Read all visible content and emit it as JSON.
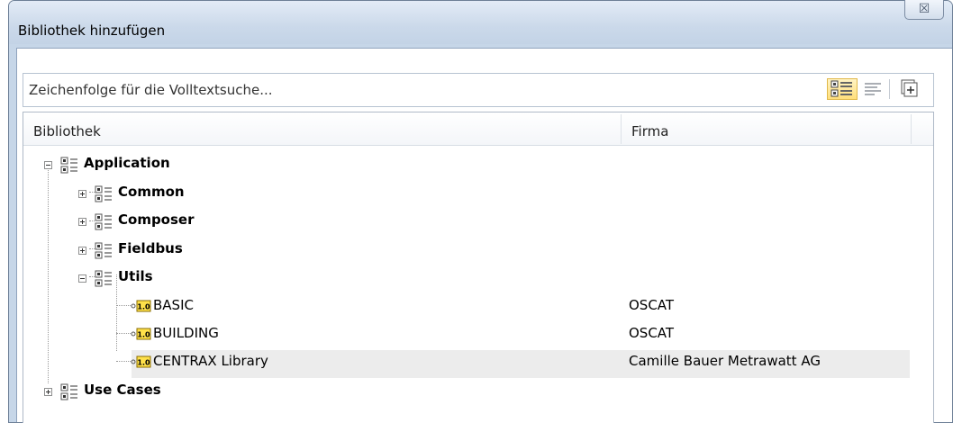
{
  "dialog": {
    "title": "Bibliothek hinzufügen",
    "close_glyph": "☒"
  },
  "search": {
    "placeholder": "Zeichenfolge für die Volltextsuche..."
  },
  "toolbar": {
    "icons": [
      "category-tree-icon",
      "list-view-icon",
      "add-library-icon"
    ]
  },
  "columns": {
    "library": "Bibliothek",
    "company": "Firma"
  },
  "tree": [
    {
      "label": "Application",
      "bold": true,
      "expanded": true,
      "firma": ""
    },
    {
      "label": "Common",
      "bold": true,
      "expanded": false,
      "firma": ""
    },
    {
      "label": "Composer",
      "bold": true,
      "expanded": false,
      "firma": ""
    },
    {
      "label": "Fieldbus",
      "bold": true,
      "expanded": false,
      "firma": ""
    },
    {
      "label": "Utils",
      "bold": true,
      "expanded": true,
      "firma": ""
    },
    {
      "label": "BASIC",
      "bold": false,
      "firma": "OSCAT"
    },
    {
      "label": "BUILDING",
      "bold": false,
      "firma": "OSCAT"
    },
    {
      "label": "CENTRAX Library",
      "bold": false,
      "firma": "Camille Bauer Metrawatt AG",
      "selected": true
    },
    {
      "label": "Use Cases",
      "bold": true,
      "expanded": false,
      "firma": ""
    }
  ],
  "colors": {
    "titlebar": "#c6d6e8",
    "selected_row": "#ececec",
    "version_badge": "#ffe14a"
  }
}
